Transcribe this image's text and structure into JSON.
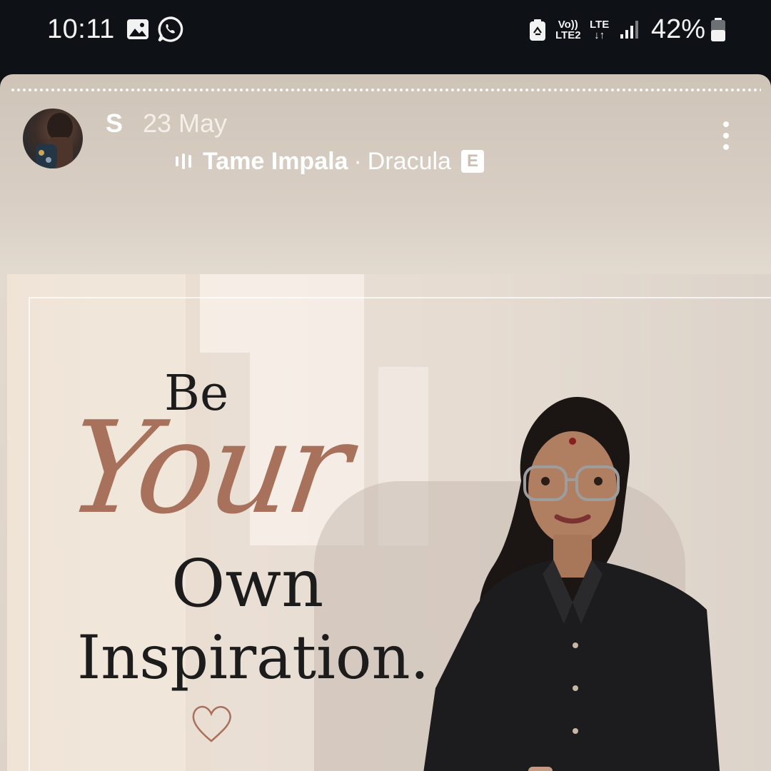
{
  "status_bar": {
    "time": "10:11",
    "left_icons": [
      "gallery-icon",
      "whatsapp-icon"
    ],
    "net_top": "Vo))",
    "net_bottom": "LTE2",
    "net2_top": "LTE",
    "net2_bottom": "↓↑",
    "battery_percent": "42%",
    "right_icons": [
      "battery-saver-icon",
      "volte-icon",
      "lte-icon",
      "signal-icon",
      "battery-icon"
    ]
  },
  "story": {
    "username": "S",
    "date": "23 May",
    "music": {
      "artist": "Tame Impala",
      "separator": "·",
      "track": "Dracula",
      "explicit_badge": "E"
    },
    "progress_segments": "dotted",
    "menu_icon": "more-vertical-icon"
  },
  "post": {
    "line1": "Be",
    "line2": "Your",
    "line3": "Own",
    "line4": "Inspiration.",
    "accent_color": "#a8715c",
    "heart_icon": "heart-outline-icon"
  }
}
